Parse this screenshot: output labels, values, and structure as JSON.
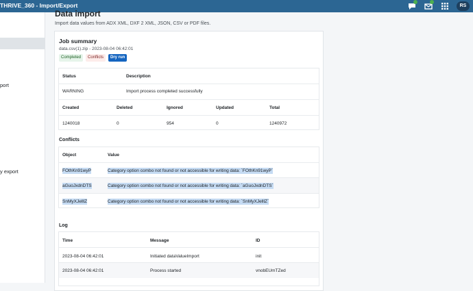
{
  "header": {
    "app_title": "THRIVE_360 - Import/Export",
    "avatar_initials": "RS"
  },
  "sidebar": {
    "items": [
      {
        "label": "port"
      },
      {
        "label": "y export"
      }
    ]
  },
  "page": {
    "title": "Data import",
    "subtitle": "Import data values from ADX XML, DXF 2 XML, JSON, CSV or PDF files."
  },
  "job_summary": {
    "title": "Job summary",
    "meta": "data.csv(1).zip - 2023-08-04 06:42:01",
    "tags": {
      "completed": "Completed",
      "conflicts": "Conflicts",
      "dry_run": "Dry run"
    }
  },
  "status_table": {
    "headers": {
      "status": "Status",
      "description": "Description"
    },
    "row": {
      "status": "WARNING",
      "description": "Import process completed successfully"
    }
  },
  "counts_table": {
    "headers": {
      "created": "Created",
      "deleted": "Deleted",
      "ignored": "Ignored",
      "updated": "Updated",
      "total": "Total"
    },
    "row": {
      "created": "1240018",
      "deleted": "0",
      "ignored": "954",
      "updated": "0",
      "total": "1240972"
    }
  },
  "conflicts": {
    "label": "Conflicts",
    "headers": {
      "object": "Object",
      "value": "Value"
    },
    "rows": [
      {
        "object": "FOthKn91wyP",
        "value": "Category option combo not found or not accessible for writing data: `FOthKn91wyP`"
      },
      {
        "object": "aGuoJxdnDTS",
        "value": "Category option combo not found or not accessible for writing data: `aGuoJxdnDTS`"
      },
      {
        "object": "SnMyXJelllZ",
        "value": "Category option combo not found or not accessible for writing data: `SnMyXJelllZ`"
      }
    ]
  },
  "log": {
    "label": "Log",
    "headers": {
      "time": "Time",
      "message": "Message",
      "id": "ID"
    },
    "rows": [
      {
        "time": "2023-08-04 06:42:01",
        "message": "Initiated dataValueImport",
        "id": "init"
      },
      {
        "time": "2023-08-04 06:42:01",
        "message": "Process started",
        "id": "vnobEUmTZed"
      }
    ]
  },
  "colors": {
    "header_bg": "#2c6693",
    "badge_green": "#4caf50",
    "dry_run_blue": "#1565c0",
    "selection": "#c5dbf3"
  }
}
